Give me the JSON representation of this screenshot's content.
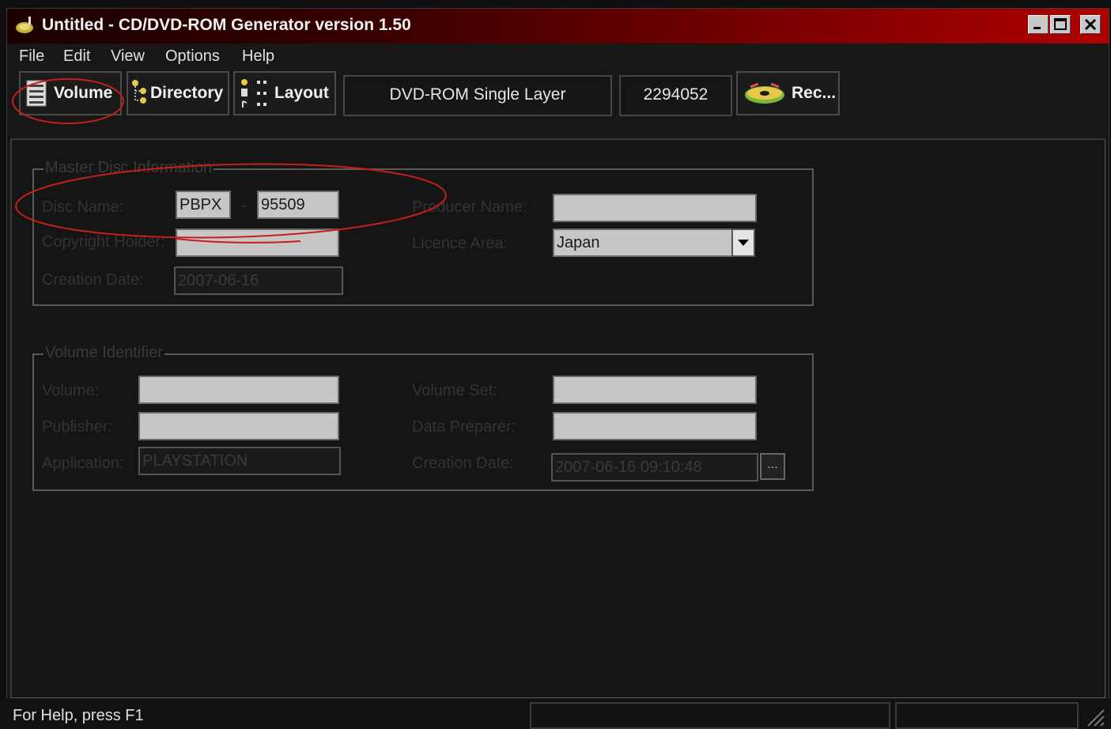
{
  "window": {
    "title": "Untitled - CD/DVD-ROM Generator version 1.50"
  },
  "menu": [
    "File",
    "Edit",
    "View",
    "Options",
    "Help"
  ],
  "toolbar": {
    "volume_label": "Volume",
    "directory_label": "Directory",
    "layout_label": "Layout",
    "disc_type": "DVD-ROM Single Layer",
    "sector_count": "2294052",
    "record_label": "Rec..."
  },
  "master_disc": {
    "group_title": "Master Disc Information",
    "disc_name_label": "Disc Name:",
    "disc_name_prefix": "PBPX",
    "disc_name_separator": "-",
    "disc_name_number": "95509",
    "producer_name_label": "Producer Name:",
    "producer_name_value": "",
    "copyright_holder_label": "Copyright Holder:",
    "copyright_holder_value": "",
    "licence_area_label": "Licence Area:",
    "licence_area_value": "Japan",
    "creation_date_label": "Creation Date:",
    "creation_date_value": "2007-06-16"
  },
  "volume_identifier": {
    "group_title": "Volume Identifier",
    "volume_label": "Volume:",
    "volume_value": "",
    "volume_set_label": "Volume Set:",
    "volume_set_value": "",
    "publisher_label": "Publisher:",
    "publisher_value": "",
    "data_preparer_label": "Data Preparer:",
    "data_preparer_value": "",
    "application_label": "Application:",
    "application_value": "PLAYSTATION",
    "creation_date_label": "Creation Date:",
    "creation_date_value": "2007-06-16 09:10:48",
    "ellipsis": "..."
  },
  "statusbar": {
    "help_text": "For Help, press F1"
  },
  "colors": {
    "annotation": "#c41e1e",
    "title_gradient_end": "#b00000"
  }
}
